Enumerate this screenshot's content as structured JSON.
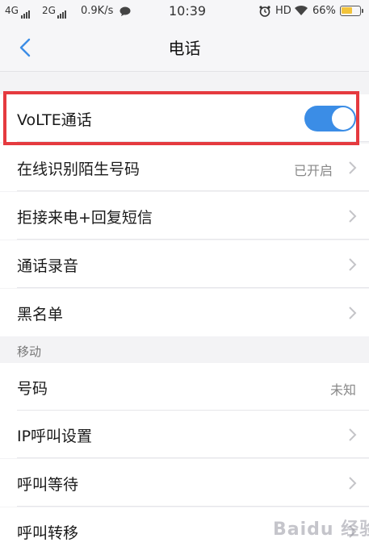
{
  "status_bar": {
    "network1": "4G",
    "network2": "2G",
    "speed": "0.9K/s",
    "time": "10:39",
    "hd": "HD",
    "battery": "66%",
    "battery_level": 0.66
  },
  "nav": {
    "title": "电话"
  },
  "rows": {
    "volte": {
      "label": "VoLTE通话",
      "toggle_on": true
    },
    "identify": {
      "label": "在线识别陌生号码",
      "value": "已开启"
    },
    "reject": {
      "label": "拒接来电+回复短信"
    },
    "record": {
      "label": "通话录音"
    },
    "blacklist": {
      "label": "黑名单"
    }
  },
  "section": {
    "title": "移动"
  },
  "mobile_rows": {
    "number": {
      "label": "号码",
      "value": "未知"
    },
    "ip": {
      "label": "IP呼叫设置"
    },
    "waiting": {
      "label": "呼叫等待"
    },
    "forward": {
      "label": "呼叫转移"
    }
  },
  "watermark": "Baidu 经验",
  "accent_color": "#3b8de6",
  "highlight_color": "#e53a3f"
}
